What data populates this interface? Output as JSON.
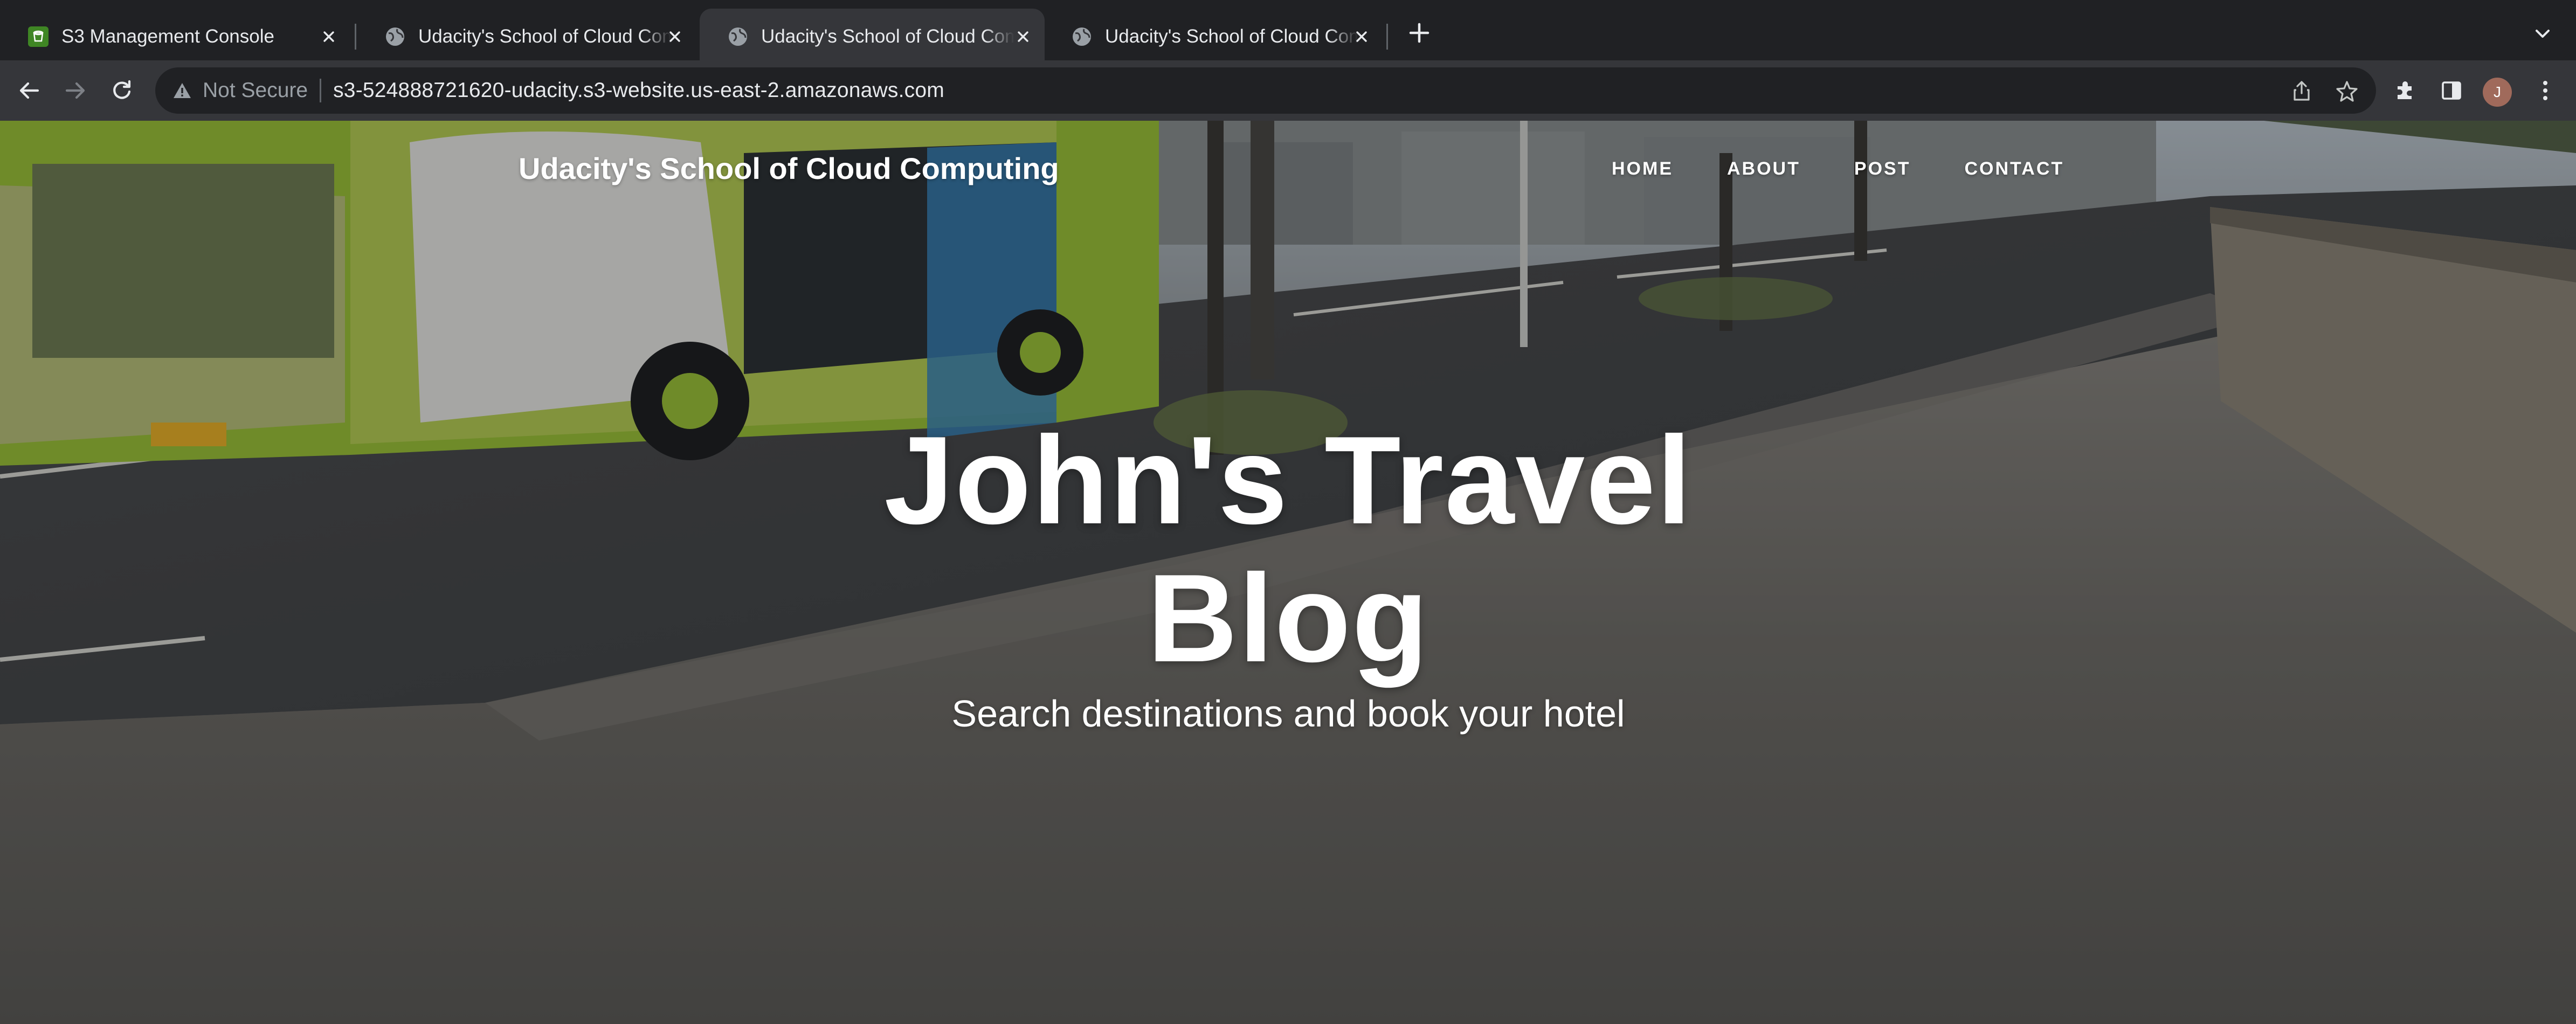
{
  "browser": {
    "tabs": [
      {
        "title": "S3 Management Console",
        "favicon": "aws-s3-icon",
        "active": false
      },
      {
        "title": "Udacity's School of Cloud Computing",
        "favicon": "globe-icon",
        "active": false
      },
      {
        "title": "Udacity's School of Cloud Computing",
        "favicon": "globe-icon",
        "active": true
      },
      {
        "title": "Udacity's School of Cloud Computing",
        "favicon": "globe-icon",
        "active": false
      }
    ],
    "security_label": "Not Secure",
    "url": "s3-524888721620-udacity.s3-website.us-east-2.amazonaws.com",
    "profile_initial": "J",
    "colors": {
      "tabstrip": "#202124",
      "toolbar": "#35363a",
      "omnibox": "#202124",
      "s3_favicon": "#3f8624",
      "avatar": "#a06a5b"
    }
  },
  "site": {
    "brand": "Udacity's School of Cloud Computing",
    "nav": [
      "Home",
      "About",
      "Post",
      "Contact"
    ],
    "hero": {
      "title_line1": "John's Travel",
      "title_line2": "Blog",
      "subtitle": "Search destinations and book your hotel"
    }
  }
}
